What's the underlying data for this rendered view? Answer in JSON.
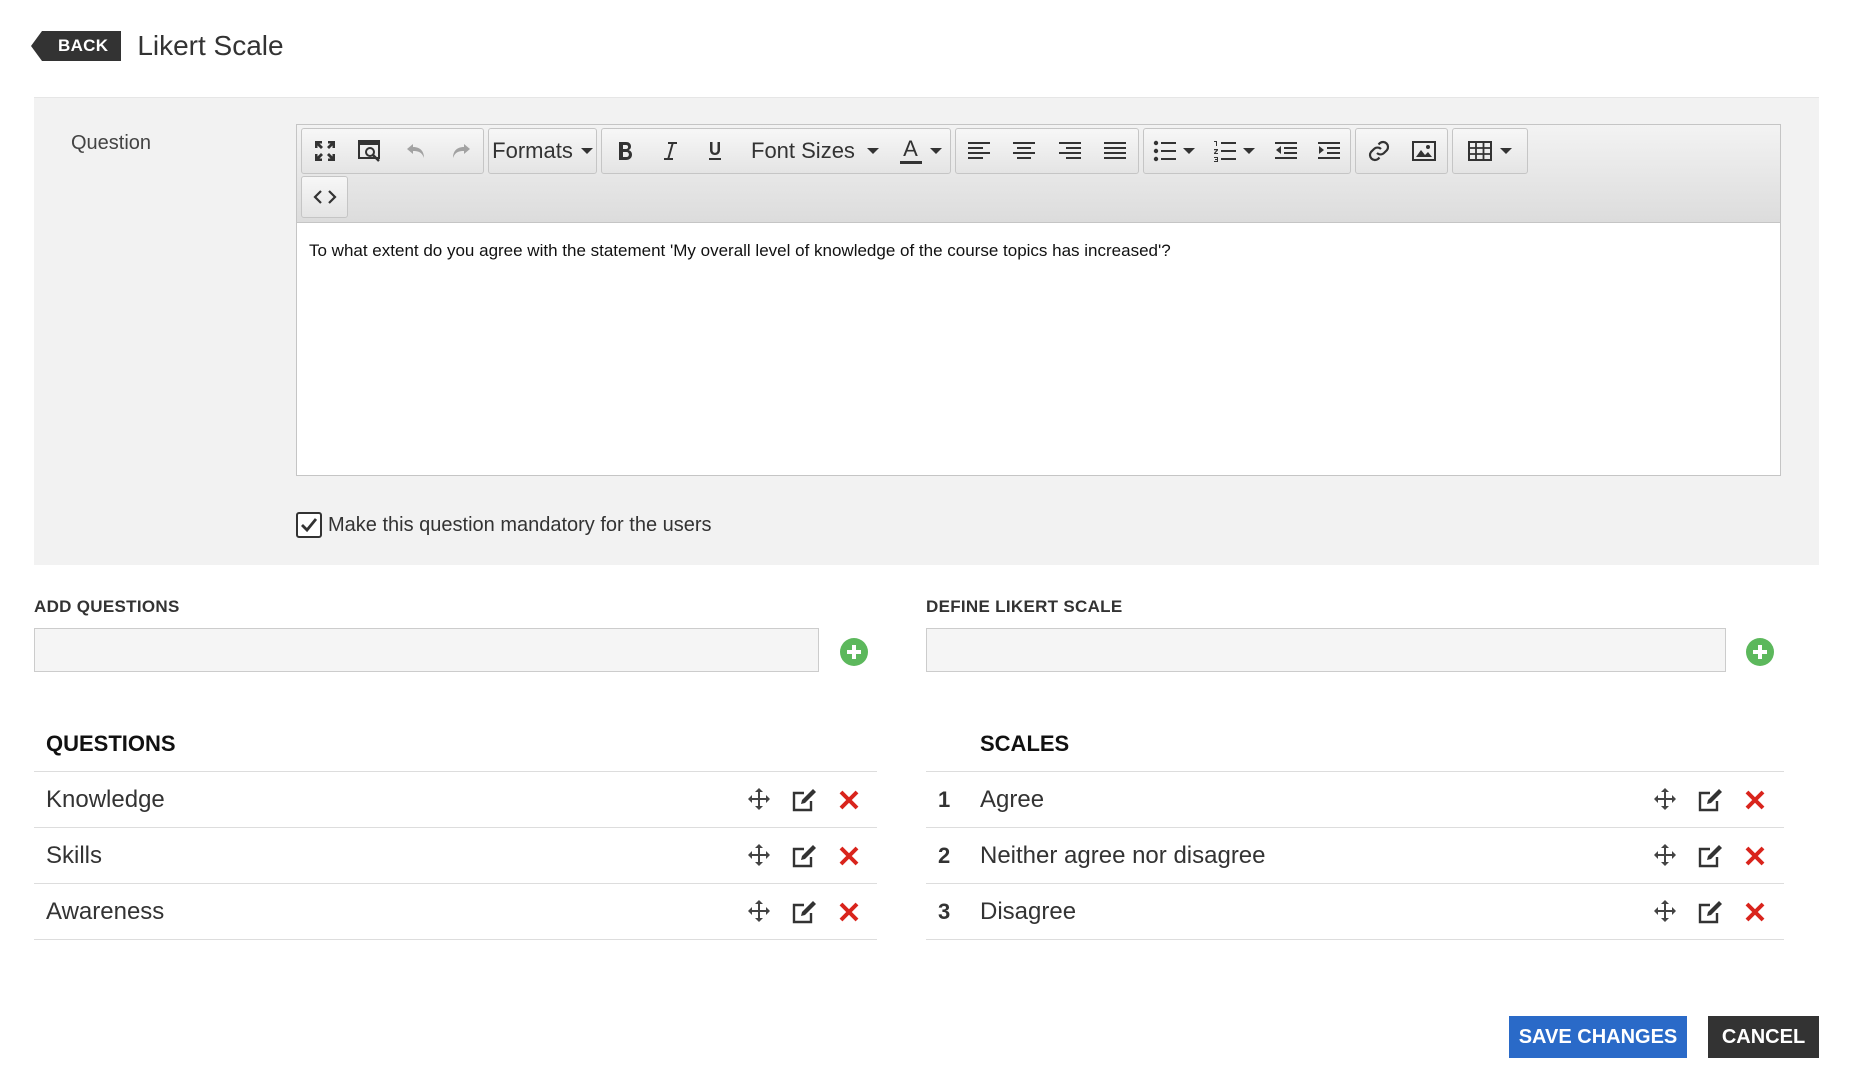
{
  "header": {
    "back_label": "BACK",
    "title": "Likert Scale"
  },
  "question": {
    "label": "Question",
    "toolbar": {
      "formats_label": "Formats",
      "font_sizes_label": "Font Sizes",
      "font_color_label": "A"
    },
    "body_text": "To what extent do you agree with the statement 'My overall level of knowledge of the course topics has increased'?",
    "mandatory_label": "Make this question mandatory for the users",
    "mandatory_checked": true
  },
  "add_questions": {
    "title": "ADD QUESTIONS",
    "value": ""
  },
  "define_scale": {
    "title": "DEFINE LIKERT SCALE",
    "value": ""
  },
  "questions_list": {
    "header": "QUESTIONS",
    "items": [
      {
        "label": "Knowledge"
      },
      {
        "label": "Skills"
      },
      {
        "label": "Awareness"
      }
    ]
  },
  "scales_list": {
    "header": "SCALES",
    "items": [
      {
        "num": "1",
        "label": "Agree"
      },
      {
        "num": "2",
        "label": "Neither agree nor disagree"
      },
      {
        "num": "3",
        "label": "Disagree"
      }
    ]
  },
  "footer": {
    "save_label": "SAVE CHANGES",
    "cancel_label": "CANCEL"
  },
  "colors": {
    "primary": "#2a6ac8",
    "dark": "#333333",
    "add": "#5cb85c",
    "delete": "#d9241c",
    "panel": "#f2f2f2"
  }
}
